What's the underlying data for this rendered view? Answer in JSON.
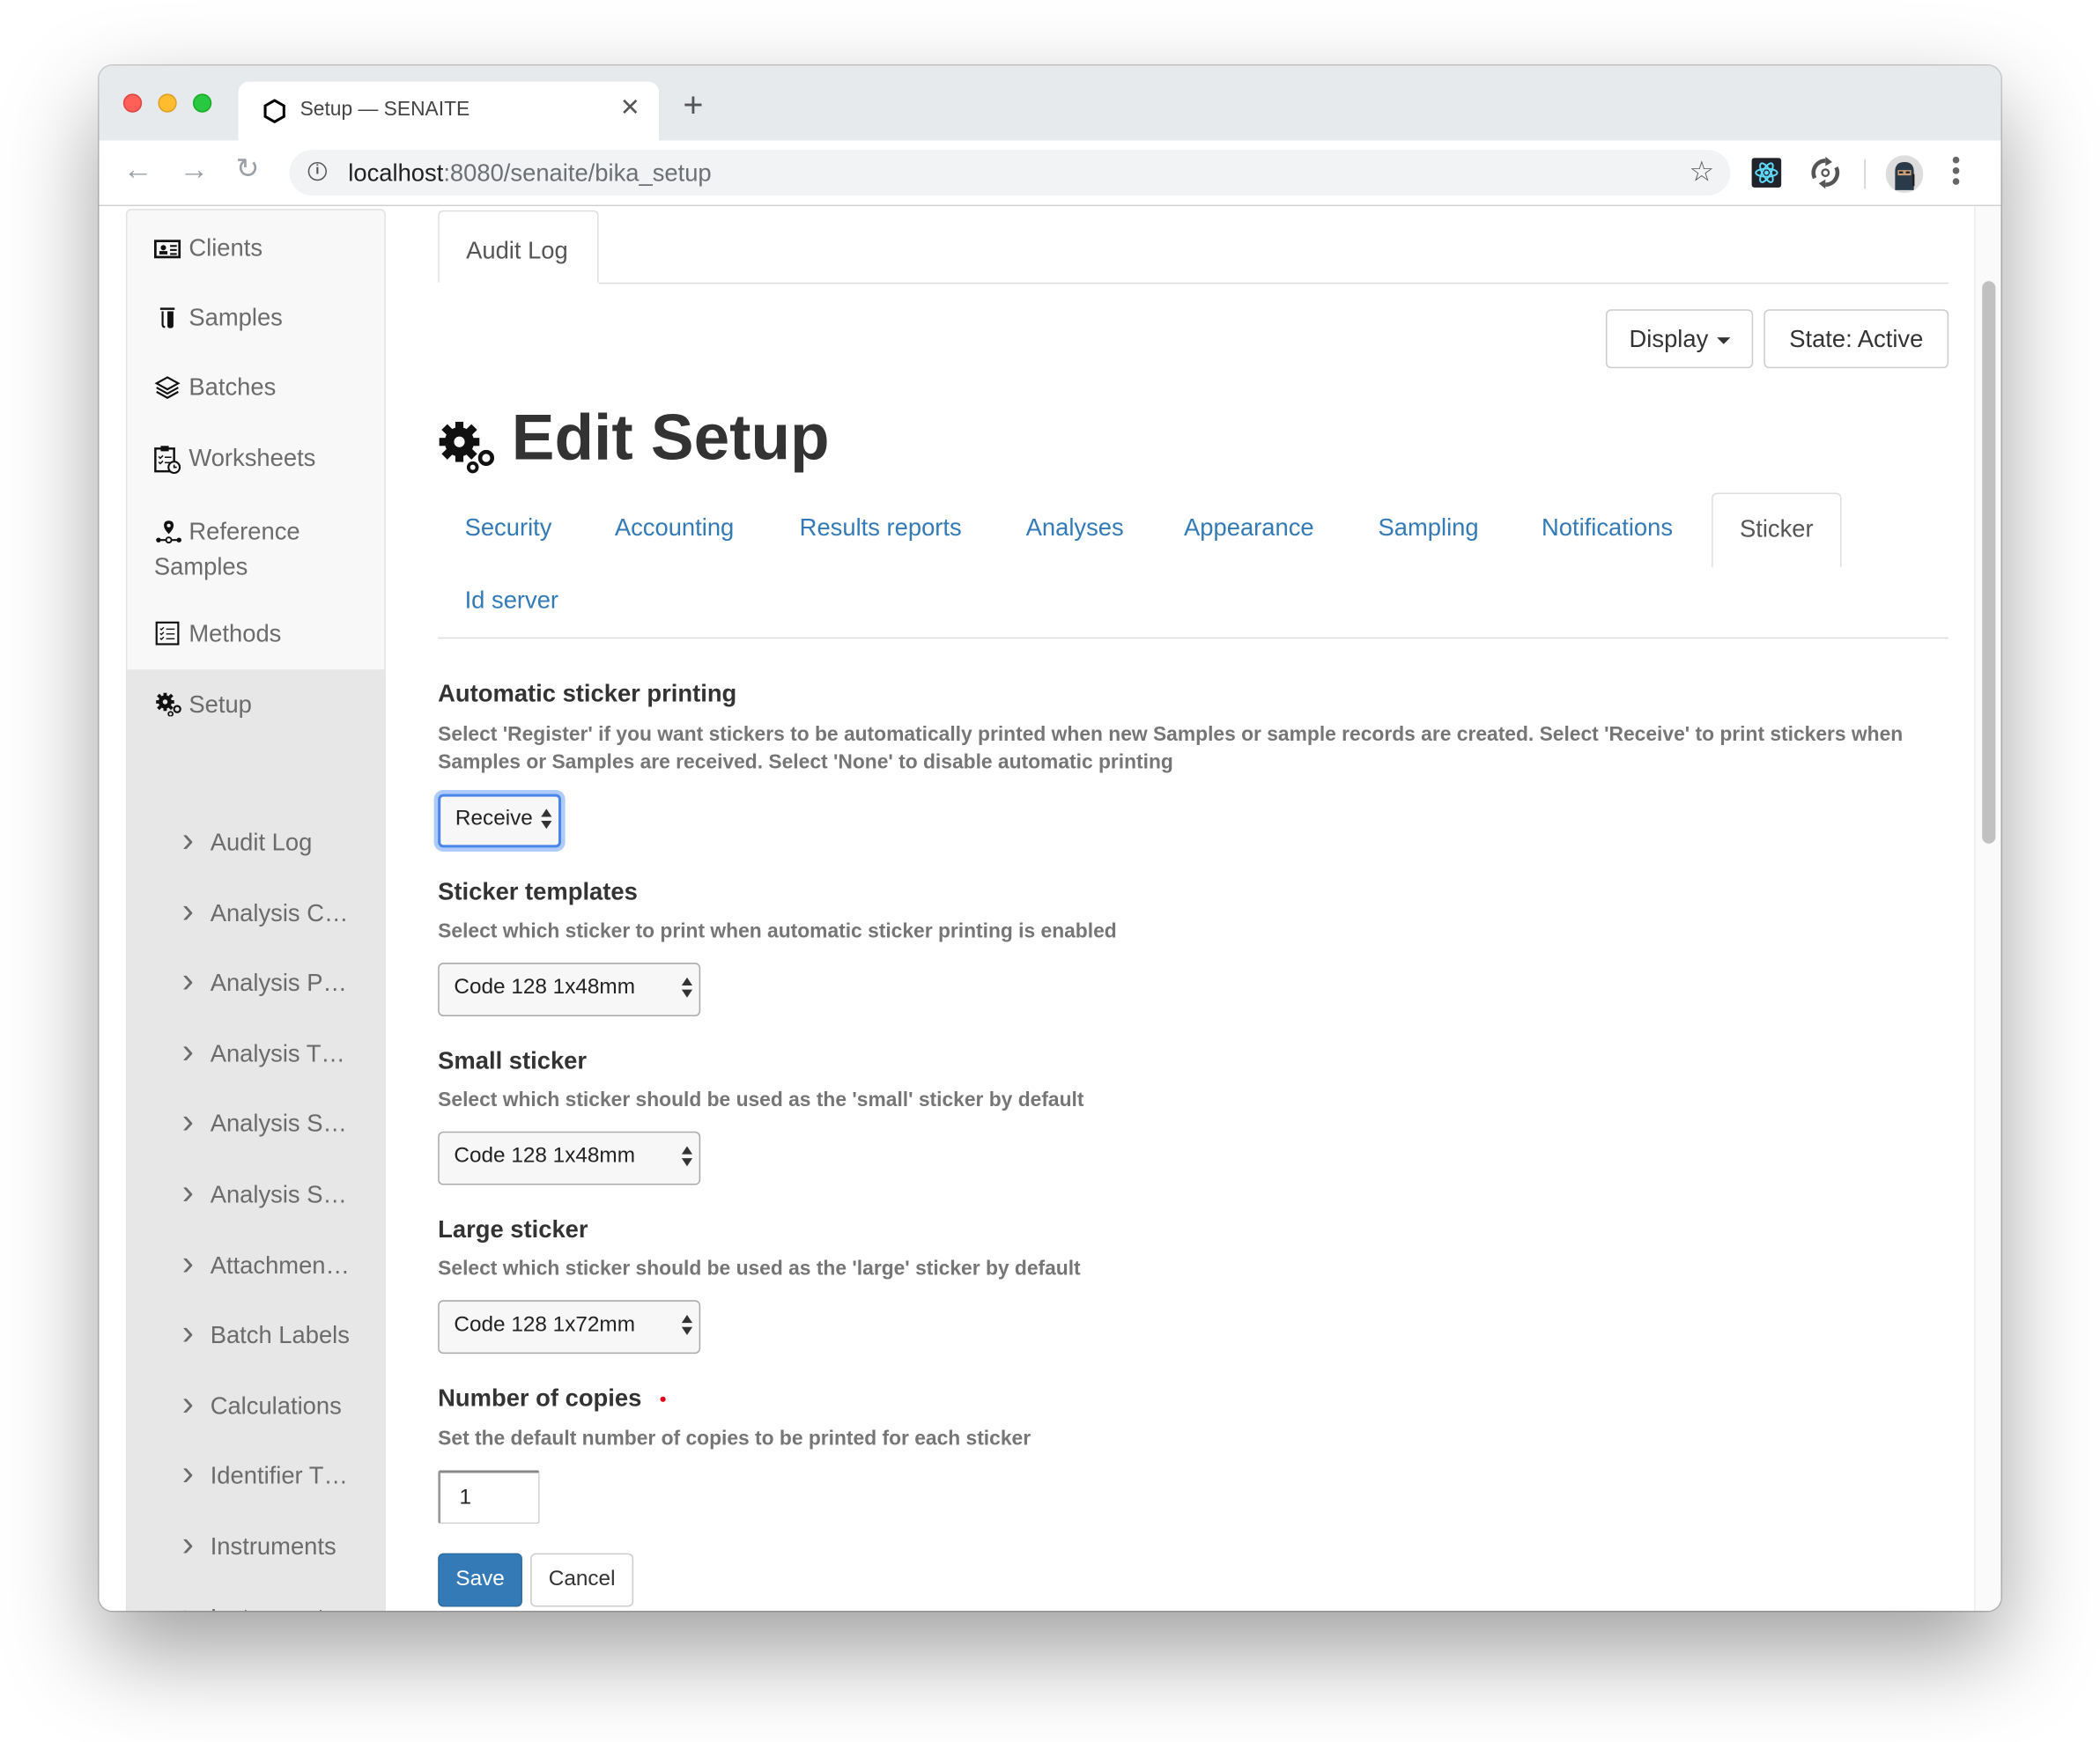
{
  "browser": {
    "tab_title": "Setup — SENAITE",
    "url_host": "localhost",
    "url_rest": ":8080/senaite/bika_setup",
    "icons": [
      "back-arrow-icon",
      "forward-arrow-icon",
      "reload-icon",
      "info-icon",
      "star-icon",
      "react-devtools-icon",
      "sync-extension-icon",
      "profile-avatar",
      "more-vert-icon"
    ]
  },
  "sidebar": {
    "items": [
      {
        "label": "Clients",
        "icon": "id-card-icon"
      },
      {
        "label": "Samples",
        "icon": "test-tubes-icon"
      },
      {
        "label": "Batches",
        "icon": "layers-icon"
      },
      {
        "label": "Worksheets",
        "icon": "clipboard-clock-icon"
      },
      {
        "label": "Reference Samples",
        "icon": "location-pin-icon"
      },
      {
        "label": "Methods",
        "icon": "checklist-icon"
      },
      {
        "label": "Setup",
        "icon": "gears-icon"
      }
    ],
    "setup_children": [
      "Audit Log",
      "Analysis C…",
      "Analysis P…",
      "Analysis T…",
      "Analysis S…",
      "Analysis S…",
      "Attachmen…",
      "Batch Labels",
      "Calculations",
      "Identifier T…",
      "Instruments",
      "Instrument…"
    ]
  },
  "content": {
    "top_tab": "Audit Log",
    "display_button": "Display",
    "state_button": "State: Active",
    "page_title": "Edit Setup",
    "tabs": [
      {
        "label": "Security",
        "active": false
      },
      {
        "label": "Accounting",
        "active": false
      },
      {
        "label": "Results reports",
        "active": false
      },
      {
        "label": "Analyses",
        "active": false
      },
      {
        "label": "Appearance",
        "active": false
      },
      {
        "label": "Sampling",
        "active": false
      },
      {
        "label": "Notifications",
        "active": false
      },
      {
        "label": "Sticker",
        "active": true
      },
      {
        "label": "Id server",
        "active": false
      }
    ],
    "fields": {
      "auto_printing": {
        "label": "Automatic sticker printing",
        "help": "Select 'Register' if you want stickers to be automatically printed when new Samples or sample records are created. Select 'Receive' to print stickers when Samples or Samples are received. Select 'None' to disable automatic printing",
        "value": "Receive"
      },
      "templates": {
        "label": "Sticker templates",
        "help": "Select which sticker to print when automatic sticker printing is enabled",
        "value": "Code 128 1x48mm"
      },
      "small": {
        "label": "Small sticker",
        "help": "Select which sticker should be used as the 'small' sticker by default",
        "value": "Code 128 1x48mm"
      },
      "large": {
        "label": "Large sticker",
        "help": "Select which sticker should be used as the 'large' sticker by default",
        "value": "Code 128 1x72mm"
      },
      "copies": {
        "label": "Number of copies",
        "help": "Set the default number of copies to be printed for each sticker",
        "value": "1",
        "required": true
      }
    },
    "save_label": "Save",
    "cancel_label": "Cancel"
  },
  "colors": {
    "link": "#337ab7",
    "primary_button": "#337ab7",
    "required": "#e3001b",
    "focus_ring": "#4a86e8"
  }
}
